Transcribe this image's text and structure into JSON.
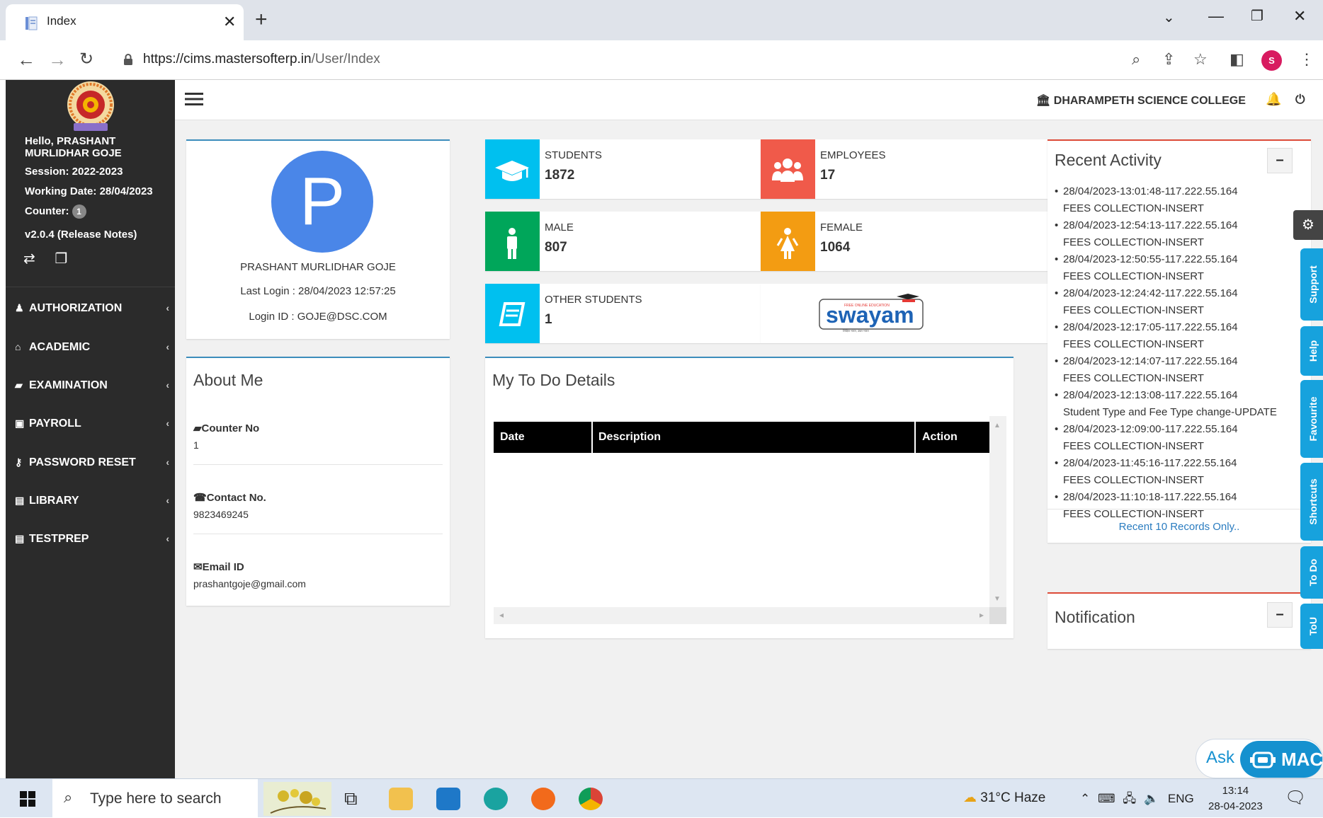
{
  "browser": {
    "tab_title": "Index",
    "url_host": "https://cims.mastersofterp.in",
    "url_path": "/User/Index",
    "profile_initial": "S"
  },
  "sidebar": {
    "greeting": "Hello, PRASHANT MURLIDHAR GOJE",
    "session": "Session: 2022-2023",
    "working_date": "Working Date: 28/04/2023",
    "counter_label": "Counter:",
    "counter_value": "1",
    "version": "v2.0.4 (Release Notes)",
    "menu": [
      {
        "label": "AUTHORIZATION",
        "icon": "users-icon"
      },
      {
        "label": "ACADEMIC",
        "icon": "graduation-cap-icon"
      },
      {
        "label": "EXAMINATION",
        "icon": "book-icon"
      },
      {
        "label": "PAYROLL",
        "icon": "money-icon"
      },
      {
        "label": "PASSWORD RESET",
        "icon": "key-icon"
      },
      {
        "label": "LIBRARY",
        "icon": "library-icon"
      },
      {
        "label": "TESTPREP",
        "icon": "testprep-icon"
      }
    ]
  },
  "header": {
    "college": "DHARAMPETH SCIENCE COLLEGE"
  },
  "profile": {
    "initial": "P",
    "name": "PRASHANT MURLIDHAR GOJE",
    "last_login": "Last Login : 28/04/2023 12:57:25",
    "login_id": "Login ID : GOJE@DSC.COM"
  },
  "about": {
    "title": "About Me",
    "counter_label": "Counter No",
    "counter_value": "1",
    "contact_label": "Contact No.",
    "contact_value": "9823469245",
    "email_label": "Email ID",
    "email_value": "prashantgoje@gmail.com"
  },
  "stats": [
    {
      "label": "STUDENTS",
      "value": "1872",
      "color": "#00c0ef"
    },
    {
      "label": "EMPLOYEES",
      "value": "17",
      "color": "#f05a4a"
    },
    {
      "label": "MALE",
      "value": "807",
      "color": "#00a65a"
    },
    {
      "label": "FEMALE",
      "value": "1064",
      "color": "#f39c12"
    },
    {
      "label": "OTHER STUDENTS",
      "value": "1",
      "color": "#00c0ef"
    }
  ],
  "swayam": {
    "logo_text": "swayam",
    "tag_top": "FREE ONLINE EDUCATION",
    "tag_bottom": "शिक्षित भारत, उन्नत भारत"
  },
  "todo": {
    "title": "My To Do Details",
    "columns": [
      "Date",
      "Description",
      "Action"
    ]
  },
  "recent": {
    "title": "Recent Activity",
    "items": [
      {
        "time": "28/04/2023-13:01:48-117.222.55.164",
        "action": "FEES COLLECTION-INSERT"
      },
      {
        "time": "28/04/2023-12:54:13-117.222.55.164",
        "action": "FEES COLLECTION-INSERT"
      },
      {
        "time": "28/04/2023-12:50:55-117.222.55.164",
        "action": "FEES COLLECTION-INSERT"
      },
      {
        "time": "28/04/2023-12:24:42-117.222.55.164",
        "action": "FEES COLLECTION-INSERT"
      },
      {
        "time": "28/04/2023-12:17:05-117.222.55.164",
        "action": "FEES COLLECTION-INSERT"
      },
      {
        "time": "28/04/2023-12:14:07-117.222.55.164",
        "action": "FEES COLLECTION-INSERT"
      },
      {
        "time": "28/04/2023-12:13:08-117.222.55.164",
        "action": "Student Type and Fee Type change-UPDATE"
      },
      {
        "time": "28/04/2023-12:09:00-117.222.55.164",
        "action": "FEES COLLECTION-INSERT"
      },
      {
        "time": "28/04/2023-11:45:16-117.222.55.164",
        "action": "FEES COLLECTION-INSERT"
      },
      {
        "time": "28/04/2023-11:10:18-117.222.55.164",
        "action": "FEES COLLECTION-INSERT"
      }
    ],
    "footer": "Recent 10 Records Only.."
  },
  "notification": {
    "title": "Notification"
  },
  "right_tabs": [
    "Support",
    "Help",
    "Favourite",
    "Shortcuts",
    "To Do",
    "ToU"
  ],
  "ask": {
    "ask": "Ask",
    "brand": "MAC"
  },
  "taskbar": {
    "search_placeholder": "Type here to search",
    "weather": "31°C  Haze",
    "lang": "ENG",
    "time": "13:14",
    "date": "28-04-2023"
  }
}
